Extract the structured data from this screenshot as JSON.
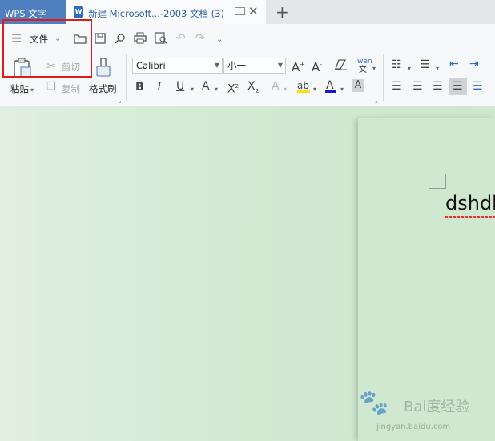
{
  "app_tab": "WPS 文字",
  "doc_tab": {
    "icon": "W",
    "title": "新建 Microsoft...-2003 文档 (3)"
  },
  "new_tab": "+",
  "toolbar": {
    "file_menu": "文件",
    "paste": "粘贴",
    "cut": "剪切",
    "copy": "复制",
    "format_painter": "格式刷",
    "font_name": "Calibri",
    "font_size": "小一",
    "wen_icon_text": "wén"
  },
  "document": {
    "text": "dshdk"
  },
  "watermark": {
    "brand": "Bai度经验",
    "url": "jingyan.baidu.com"
  },
  "colors": {
    "app_tab_bg": "#4f7fbf",
    "highlight_box": "#e01b1b",
    "canvas_bg": "#d3e9d3"
  }
}
